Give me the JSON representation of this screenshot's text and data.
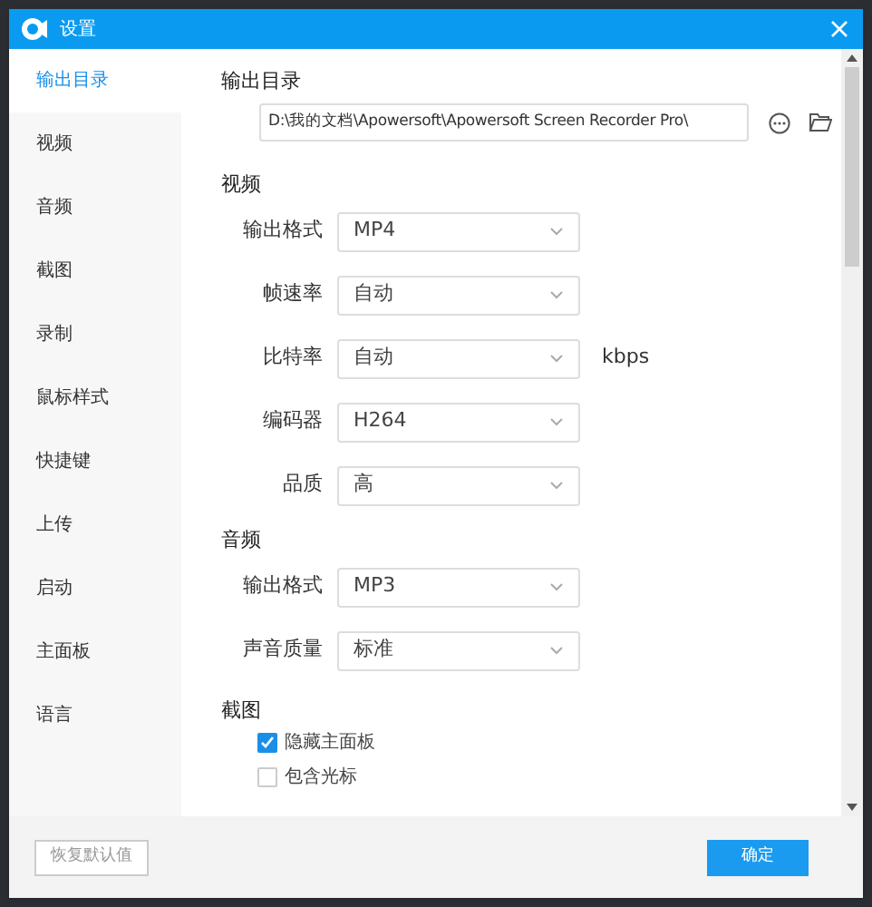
{
  "window": {
    "title": "设置"
  },
  "sidebar": {
    "items": [
      {
        "label": "输出目录",
        "selected": true
      },
      {
        "label": "视频",
        "selected": false
      },
      {
        "label": "音频",
        "selected": false
      },
      {
        "label": "截图",
        "selected": false
      },
      {
        "label": "录制",
        "selected": false
      },
      {
        "label": "鼠标样式",
        "selected": false
      },
      {
        "label": "快捷键",
        "selected": false
      },
      {
        "label": "上传",
        "selected": false
      },
      {
        "label": "启动",
        "selected": false
      },
      {
        "label": "主面板",
        "selected": false
      },
      {
        "label": "语言",
        "selected": false
      }
    ]
  },
  "output_dir": {
    "heading": "输出目录",
    "path": "D:\\我的文档\\Apowersoft\\Apowersoft Screen Recorder Pro\\"
  },
  "video": {
    "heading": "视频",
    "rows": [
      {
        "label": "输出格式",
        "value": "MP4"
      },
      {
        "label": "帧速率",
        "value": "自动"
      },
      {
        "label": "比特率",
        "value": "自动",
        "unit": "kbps"
      },
      {
        "label": "编码器",
        "value": "H264"
      },
      {
        "label": "品质",
        "value": "高"
      }
    ]
  },
  "audio": {
    "heading": "音频",
    "rows": [
      {
        "label": "输出格式",
        "value": "MP3"
      },
      {
        "label": "声音质量",
        "value": "标准"
      }
    ]
  },
  "screenshot": {
    "heading": "截图",
    "options": [
      {
        "label": "隐藏主面板",
        "checked": true
      },
      {
        "label": "包含光标",
        "checked": false
      }
    ]
  },
  "footer": {
    "reset": "恢复默认值",
    "ok": "确定"
  }
}
